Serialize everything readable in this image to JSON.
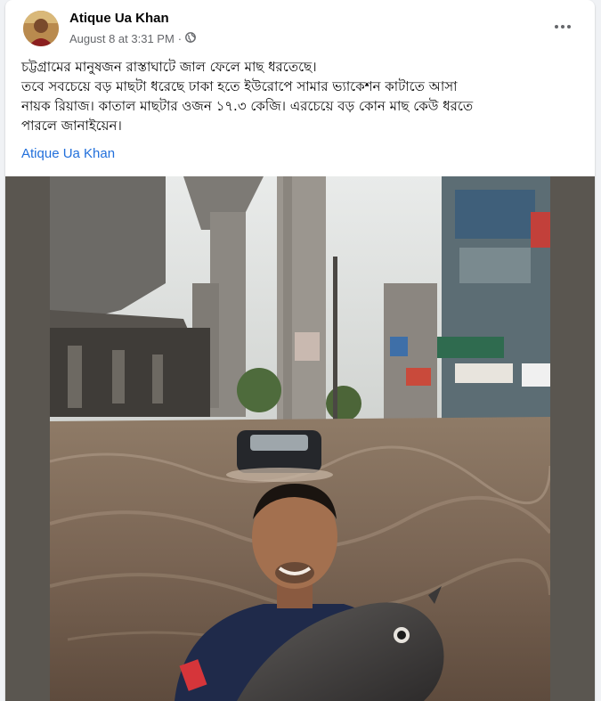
{
  "post": {
    "author": "Atique Ua Khan",
    "timestamp": "August 8 at 3:31 PM",
    "separator": "·",
    "audience_icon": "globe-icon",
    "more_icon": "more-options-icon",
    "text_lines": [
      "চট্টগ্রামের মানুষজন রাস্তাঘাটে জাল ফেলে মাছ ধরতেছে।",
      "তবে সবচেয়ে বড় মাছটা ধরেছে ঢাকা হতে ইউরোপে সামার ভ্যাকেশন কাটাতে আসা",
      "নায়ক রিয়াজ। কাতাল মাছটার ওজন ১৭.৩ কেজি। এরচেয়ে বড় কোন মাছ কেউ ধরতে",
      "পারলে জানাইয়েন।"
    ],
    "signature_link": "Atique Ua Khan"
  },
  "colors": {
    "link": "#216fdb",
    "text": "#050505",
    "secondary": "#65676b",
    "background": "#f0f2f5"
  }
}
